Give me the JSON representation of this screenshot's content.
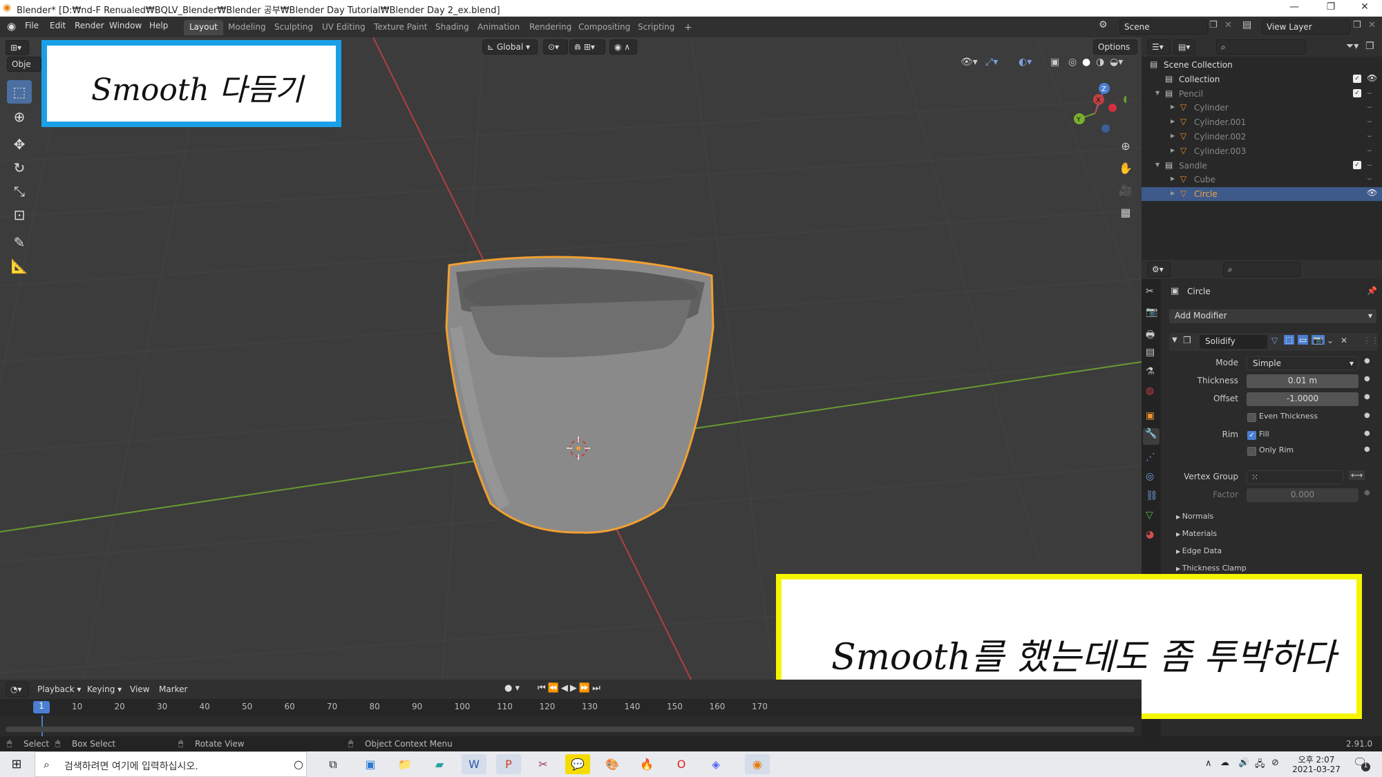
{
  "window": {
    "title": "Blender* [D:₩nd-F Renualed₩BQLV_Blender₩Blender 공부₩Blender Day Tutorial₩Blender Day 2_ex.blend]",
    "minimize": "—",
    "maximize": "❐",
    "close": "✕"
  },
  "menubar": {
    "menus": [
      "File",
      "Edit",
      "Render",
      "Window",
      "Help"
    ],
    "workspaces": [
      "Layout",
      "Modeling",
      "Sculpting",
      "UV Editing",
      "Texture Paint",
      "Shading",
      "Animation",
      "Rendering",
      "Compositing",
      "Scripting"
    ],
    "active_workspace": "Layout",
    "add_workspace": "+",
    "scene": "Scene",
    "view_layer": "View Layer"
  },
  "viewport": {
    "mode_label": "Obje",
    "orientation": "Global",
    "options": "Options",
    "gizmo": {
      "z": "Z",
      "y": "Y",
      "x": "X"
    }
  },
  "overlays": {
    "top_left": "Smooth 다듬기",
    "bottom_right": "Smooth를 했는데도 좀 투박하다"
  },
  "outliner": {
    "items": [
      {
        "label": "Scene Collection",
        "level": 0,
        "dim": false,
        "selected": false,
        "check": false,
        "eye": false
      },
      {
        "label": "Collection",
        "level": 1,
        "dim": false,
        "selected": false,
        "check": true,
        "eye": true
      },
      {
        "label": "Pencil",
        "level": 1,
        "dim": true,
        "selected": false,
        "check": true,
        "eye": false
      },
      {
        "label": "Cylinder",
        "level": 2,
        "dim": true,
        "selected": false,
        "check": false,
        "eye": false
      },
      {
        "label": "Cylinder.001",
        "level": 2,
        "dim": true,
        "selected": false,
        "check": false,
        "eye": false
      },
      {
        "label": "Cylinder.002",
        "level": 2,
        "dim": true,
        "selected": false,
        "check": false,
        "eye": false
      },
      {
        "label": "Cylinder.003",
        "level": 2,
        "dim": true,
        "selected": false,
        "check": false,
        "eye": false
      },
      {
        "label": "Sandle",
        "level": 1,
        "dim": true,
        "selected": false,
        "check": true,
        "eye": false
      },
      {
        "label": "Cube",
        "level": 2,
        "dim": true,
        "selected": false,
        "check": false,
        "eye": false
      },
      {
        "label": "Circle",
        "level": 2,
        "dim": false,
        "selected": true,
        "check": false,
        "eye": true
      }
    ]
  },
  "properties": {
    "object_name": "Circle",
    "add_modifier": "Add Modifier",
    "modifier_name": "Solidify",
    "fields": {
      "mode_label": "Mode",
      "mode_value": "Simple",
      "thickness_label": "Thickness",
      "thickness_value": "0.01 m",
      "offset_label": "Offset",
      "offset_value": "-1.0000",
      "even_thickness": "Even Thickness",
      "rim_label": "Rim",
      "fill": "Fill",
      "only_rim": "Only Rim",
      "vertex_group_label": "Vertex Group",
      "factor_label": "Factor",
      "factor_value": "0.000"
    },
    "panels": [
      "Normals",
      "Materials",
      "Edge Data",
      "Thickness Clamp"
    ]
  },
  "timeline": {
    "menus": [
      "Playback",
      "Keying",
      "View",
      "Marker"
    ],
    "current_frame": "1",
    "ticks": [
      "10",
      "20",
      "30",
      "40",
      "50",
      "60",
      "70",
      "80",
      "90",
      "100",
      "110",
      "120",
      "130",
      "140",
      "150",
      "160",
      "170"
    ]
  },
  "statusbar": {
    "select": "Select",
    "box_select": "Box Select",
    "rotate_view": "Rotate View",
    "context_menu": "Object Context Menu",
    "version": "2.91.0"
  },
  "taskbar": {
    "search_placeholder": "검색하려면 여기에 입력하십시오.",
    "time": "오후 2:07",
    "date": "2021-03-27",
    "notif_count": "1"
  },
  "colors": {
    "accent": "#4a7ed0",
    "selection_outline": "#f0a030",
    "overlay_border_blue": "#1aa0e8",
    "overlay_border_yellow": "#f5f500",
    "x_axis": "#b04040",
    "y_axis": "#6a9a30"
  }
}
